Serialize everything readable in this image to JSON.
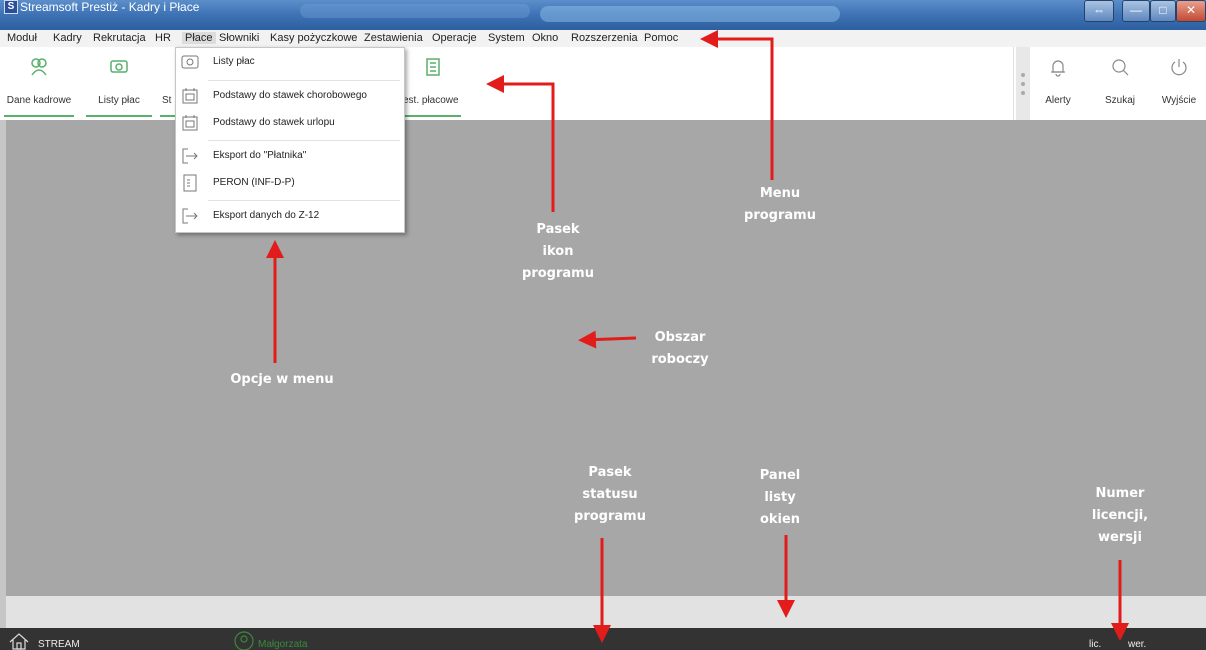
{
  "window": {
    "title": "Streamsoft Prestiż - Kadry i Płace",
    "app_icon": "S",
    "buttons": {
      "restore": "⇔",
      "minimize": "—",
      "maximize": "□",
      "close": "✕"
    }
  },
  "menubar": {
    "items": [
      "Moduł",
      "Kadry",
      "Rekrutacja",
      "HR",
      "Płace",
      "Słowniki",
      "Kasy pożyczkowe",
      "Zestawienia",
      "Operacje",
      "System",
      "Okno",
      "Rozszerzenia",
      "Pomoc"
    ],
    "active": "Płace"
  },
  "ribbon": {
    "left": [
      {
        "label": "Dane kadrowe",
        "icon": "employees-icon"
      },
      {
        "label": "Listy płac",
        "icon": "payroll-icon"
      },
      {
        "label": "St",
        "icon": "icon"
      },
      {
        "label": "est. płacowe",
        "icon": "report-icon"
      }
    ],
    "right": [
      {
        "label": "Alerty",
        "icon": "bell-icon"
      },
      {
        "label": "Szukaj",
        "icon": "search-icon"
      },
      {
        "label": "Wyjście",
        "icon": "power-icon"
      }
    ]
  },
  "dropdown": {
    "items": [
      {
        "label": "Listy płac",
        "icon": "payroll-icon"
      },
      {
        "label": "Podstawy do stawek chorobowego",
        "icon": "calendar-icon"
      },
      {
        "label": "Podstawy do stawek urlopu",
        "icon": "calendar-icon"
      },
      {
        "label": "Eksport do \"Płatnika\"",
        "icon": "export-icon"
      },
      {
        "label": "PERON (INF-D-P)",
        "icon": "document-icon"
      },
      {
        "label": "Eksport danych do Z-12",
        "icon": "export-icon"
      }
    ]
  },
  "annotations": {
    "menu": [
      "Menu",
      "programu"
    ],
    "toolbar": [
      "Pasek",
      "ikon",
      "programu"
    ],
    "workarea": [
      "Obszar",
      "roboczy"
    ],
    "options": [
      "Opcje w menu"
    ],
    "statusbar": [
      "Pasek",
      "statusu",
      "programu"
    ],
    "windows_panel": [
      "Panel",
      "listy",
      "okien"
    ],
    "license": [
      "Numer",
      "licencji,",
      "wersji"
    ]
  },
  "status": {
    "app": "STREAM",
    "user": "Małgorzata",
    "license": "lic.",
    "version": "wer."
  },
  "colors": {
    "accent": "#58b06a",
    "annotation_arrow": "#e21b1b",
    "workspace": "#a7a7a7"
  }
}
